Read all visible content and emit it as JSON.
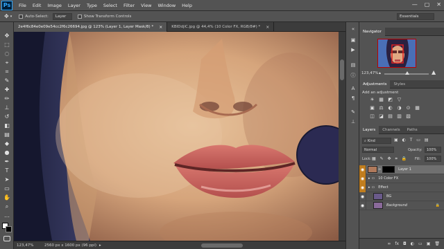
{
  "app": {
    "logo": "Ps"
  },
  "menu": [
    "File",
    "Edit",
    "Image",
    "Layer",
    "Type",
    "Select",
    "Filter",
    "View",
    "Window",
    "Help"
  ],
  "window_controls": [
    "—",
    "▢",
    "✕"
  ],
  "options": {
    "auto_select_label": "Auto-Select:",
    "auto_select_value": "Layer",
    "transform_label": "Show Transform Controls",
    "workspace": "Essentials"
  },
  "tabs": [
    {
      "label": "2e4f6c84e0e09e54cc2f6c26694.jpg @ 123% (Layer 1, Layer Mask/8) *",
      "close": "×"
    },
    {
      "label": "KBIDdjiC.jpg @ 44,4% (10 Color FX, RGB/8#) *",
      "close": "×"
    }
  ],
  "status": {
    "zoom": "123,47%",
    "doc": "2560 px x 1600 px (96 ppi)"
  },
  "navigator": {
    "tab": "Navigator",
    "zoom": "123,47%"
  },
  "adjustments": {
    "tabs": [
      "Adjustments",
      "Styles"
    ],
    "add_label": "Add an adjustment",
    "row1": [
      "☀",
      "▦",
      "◩",
      "▽"
    ],
    "row2": [
      "▣",
      "⚖",
      "◐",
      "◑",
      "⊙",
      "▦"
    ],
    "row3": [
      "◫",
      "◪",
      "▤",
      "▥",
      "▧"
    ]
  },
  "layers": {
    "tabs": [
      "Layers",
      "Channels",
      "Paths"
    ],
    "kind": "Kind",
    "blend_mode": "Normal",
    "opacity_label": "Opacity:",
    "opacity": "100%",
    "lock_label": "Lock:",
    "fill_label": "Fill:",
    "fill": "100%",
    "items": [
      {
        "name": "Layer 1",
        "selected": true
      },
      {
        "name": "10 Color FX"
      },
      {
        "name": "Effect"
      },
      {
        "name": "BG"
      },
      {
        "name": "Background"
      }
    ],
    "footer": [
      "fx",
      "◘",
      "◐",
      "▭",
      "▣",
      "🗑"
    ]
  },
  "colors": {
    "accent": "#31a8ff",
    "panel": "#535353",
    "eye_highlight": "#c07d1e"
  }
}
